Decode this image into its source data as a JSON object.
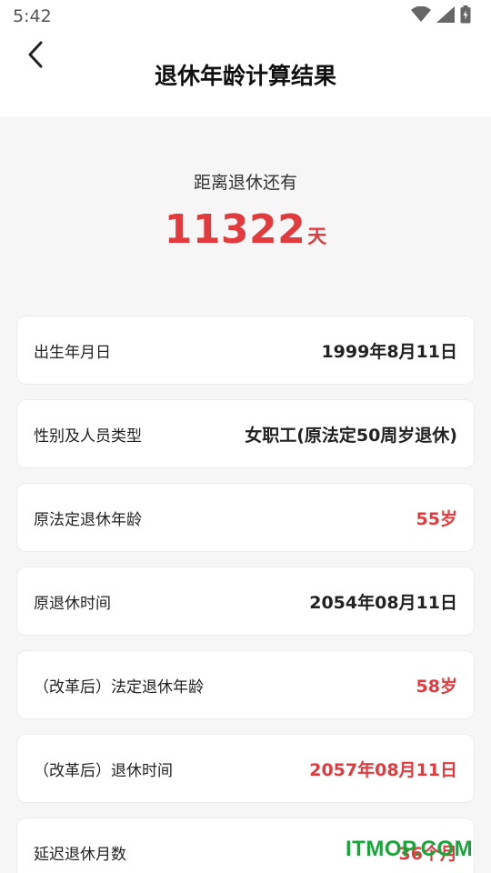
{
  "status_bar": {
    "time": "5:42",
    "icons": [
      "wifi-icon",
      "signal-icon",
      "battery-icon"
    ]
  },
  "header": {
    "title": "退休年龄计算结果",
    "back_icon": "chevron-left-icon"
  },
  "summary": {
    "label": "距离退休还有",
    "days": "11322",
    "unit": "天"
  },
  "rows": [
    {
      "label": "出生年月日",
      "value": "1999年8月11日",
      "highlight": false
    },
    {
      "label": "性别及人员类型",
      "value": "女职工(原法定50周岁退休)",
      "highlight": false
    },
    {
      "label": "原法定退休年龄",
      "value": "55岁",
      "highlight": true
    },
    {
      "label": "原退休时间",
      "value": "2054年08月11日",
      "highlight": false
    },
    {
      "label": "（改革后）法定退休年龄",
      "value": "58岁",
      "highlight": true
    },
    {
      "label": "（改革后）退休时间",
      "value": "2057年08月11日",
      "highlight": true
    },
    {
      "label": "延迟退休月数",
      "value": "36个月",
      "highlight": true
    }
  ],
  "watermark": "ITMOP.COM",
  "colors": {
    "accent_red": "#e23a3d",
    "watermark_green": "#18a63a",
    "background": "#f6f6f6"
  }
}
